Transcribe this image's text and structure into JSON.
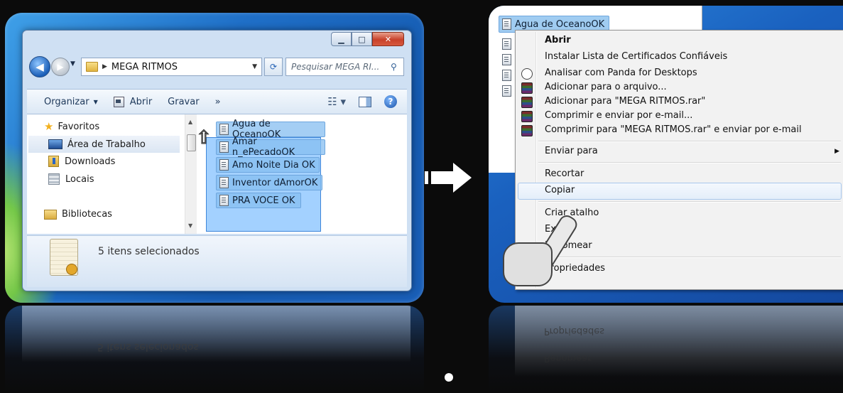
{
  "explorer": {
    "address": "MEGA RITMOS",
    "search_placeholder": "Pesquisar MEGA RI...",
    "toolbar": {
      "organize": "Organizar",
      "open": "Abrir",
      "burn": "Gravar",
      "more": "»"
    },
    "nav": {
      "favorites": "Favoritos",
      "desktop": "Área de Trabalho",
      "downloads": "Downloads",
      "places": "Locais",
      "libraries": "Bibliotecas"
    },
    "files": [
      "Agua de OceanoOK",
      "Amar n_ePecadoOK",
      "Amo Noite Dia OK",
      "Inventor dAmorOK",
      "PRA VOCE OK"
    ],
    "status": "5 itens selecionados"
  },
  "context": {
    "file_name": "Agua de OceanoOK",
    "menu": [
      "Abrir",
      "Instalar  Lista de Certificados Confiáveis",
      "Analisar com Panda for Desktops",
      "Adicionar para o arquivo...",
      "Adicionar para \"MEGA RITMOS.rar\"",
      "Comprimir e enviar por e-mail...",
      "Comprimir para \"MEGA RITMOS.rar\" e enviar por e-mail",
      "Enviar para",
      "Recortar",
      "Copiar",
      "Criar atalho",
      "Excluir",
      "Renomear",
      "Propriedades"
    ],
    "highlighted": "Copiar"
  },
  "reflection": {
    "left_status": "5 itens selecionados",
    "right_a": "Propriedades",
    "right_b": "Renomear"
  },
  "colors": {
    "aero_blue": "#1f6fc7",
    "selection": "#3399ff",
    "menu_bg": "#f2f2f2"
  }
}
